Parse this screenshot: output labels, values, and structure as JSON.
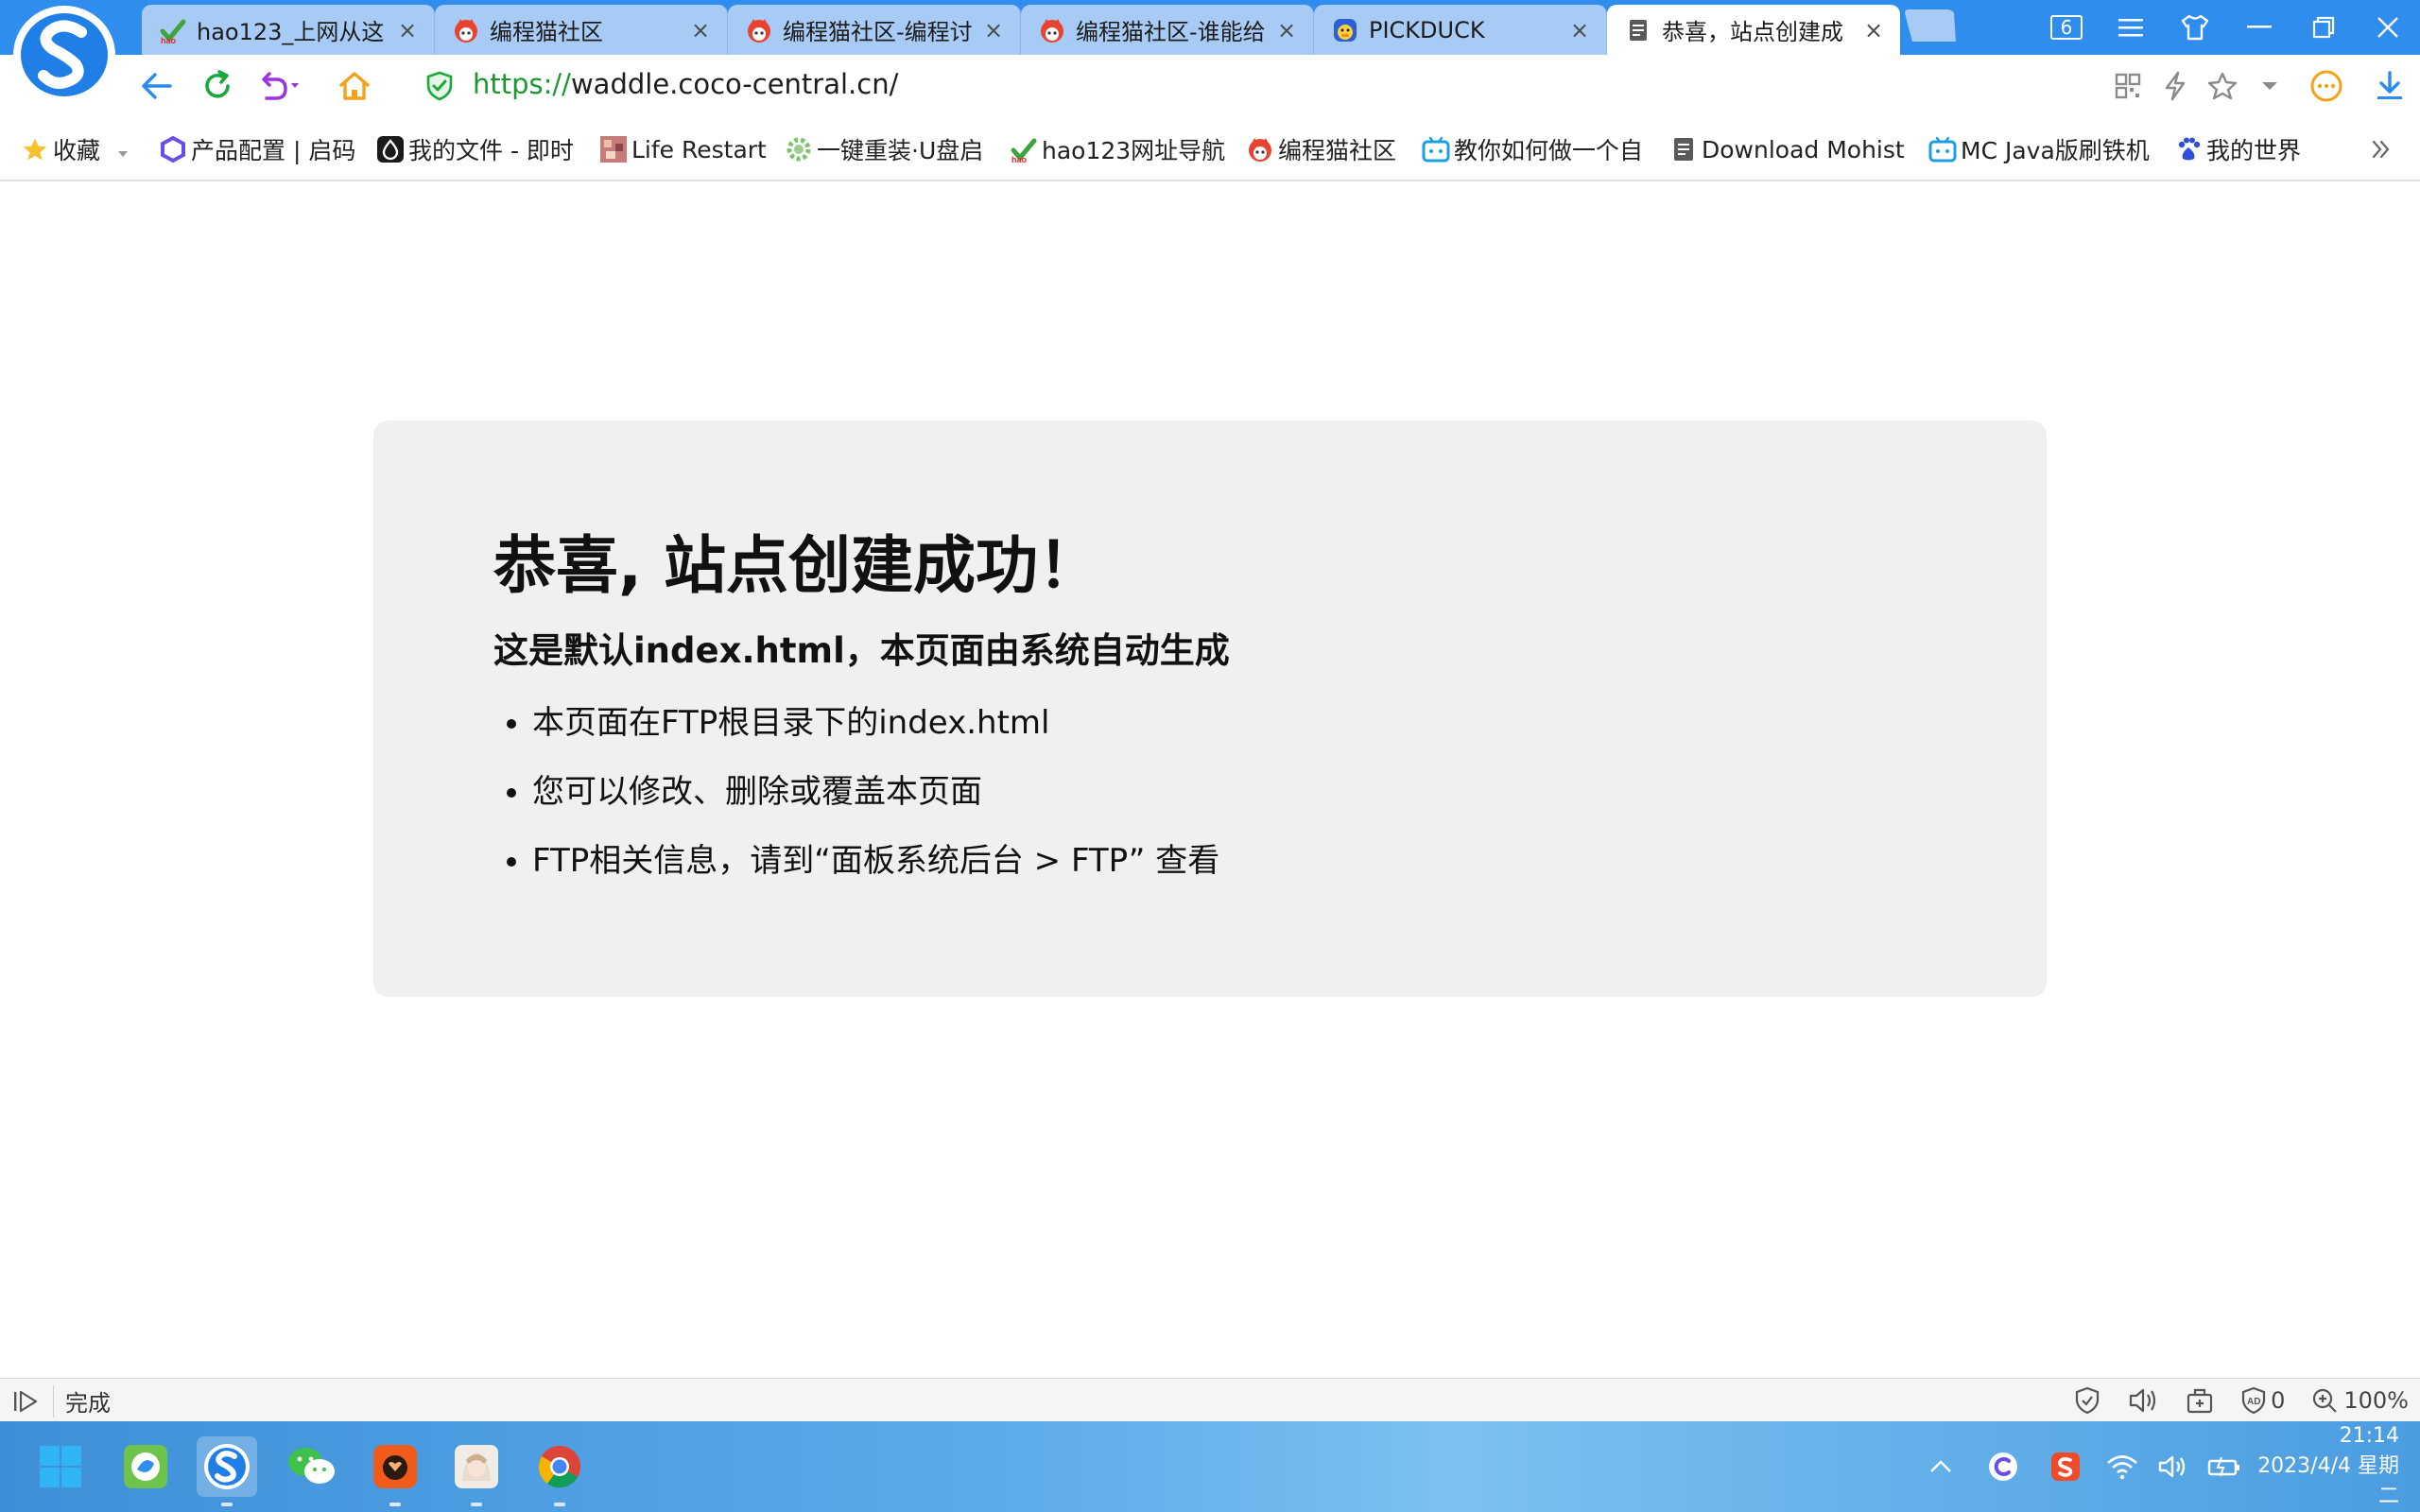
{
  "browser": {
    "tabs": [
      {
        "title": "hao123_上网从这",
        "icon": "hao123-icon"
      },
      {
        "title": "编程猫社区",
        "icon": "codemao-icon"
      },
      {
        "title": "编程猫社区-编程讨",
        "icon": "codemao-icon"
      },
      {
        "title": "编程猫社区-谁能给",
        "icon": "codemao-icon"
      },
      {
        "title": "PICKDUCK",
        "icon": "pickduck-icon"
      },
      {
        "title": "恭喜，站点创建成",
        "icon": "document-icon",
        "active": true
      }
    ],
    "close_glyph": "×",
    "tab_count": "6",
    "url_scheme": "https://",
    "url_rest": "waddle.coco-central.cn/"
  },
  "bookmarks": [
    {
      "label": "收藏",
      "icon": "star-icon"
    },
    {
      "label": "产品配置 | 启码",
      "icon": "hexagon-icon"
    },
    {
      "label": "我的文件 - 即时",
      "icon": "drop-icon"
    },
    {
      "label": "Life Restart",
      "icon": "pixel-icon"
    },
    {
      "label": "一键重装·U盘启",
      "icon": "gear-icon"
    },
    {
      "label": "hao123网址导航",
      "icon": "hao123-icon"
    },
    {
      "label": "编程猫社区",
      "icon": "codemao-icon"
    },
    {
      "label": "教你如何做一个自",
      "icon": "bilibili-icon"
    },
    {
      "label": "Download Mohist",
      "icon": "document-icon"
    },
    {
      "label": "MC Java版刷铁机",
      "icon": "bilibili-icon"
    },
    {
      "label": "我的世界",
      "icon": "baidu-paw-icon"
    }
  ],
  "page": {
    "heading": "恭喜, 站点创建成功！",
    "subheading": "这是默认index.html，本页面由系统自动生成",
    "items": [
      "本页面在FTP根目录下的index.html",
      "您可以修改、删除或覆盖本页面",
      "FTP相关信息，请到“面板系统后台 > FTP” 查看"
    ]
  },
  "status": {
    "text": "完成",
    "ad_count": "0",
    "zoom": "100%"
  },
  "taskbar": {
    "time": "21:14",
    "date": "2023/4/4 星期二"
  },
  "colors": {
    "titlebar": "#2f8dee",
    "tab_inactive": "#a7cbf5",
    "url_secure": "#1a9a2e",
    "card_bg": "#f0f0f0"
  }
}
